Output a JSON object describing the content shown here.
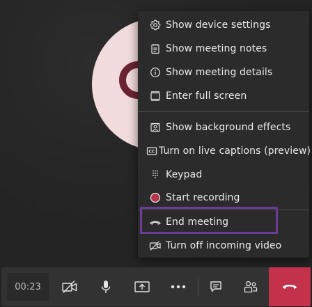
{
  "colors": {
    "background": "#262626",
    "menu_background": "#2b2b2b",
    "avatar_fill": "#f1dbdc",
    "avatar_ring": "#6a2331",
    "highlight_border": "#6b3d96",
    "end_call": "#c4314b",
    "record_dot": "#b8364c"
  },
  "menu": {
    "items": [
      {
        "label": "Show device settings",
        "icon": "gear-icon"
      },
      {
        "label": "Show meeting notes",
        "icon": "notes-icon"
      },
      {
        "label": "Show meeting details",
        "icon": "info-icon"
      },
      {
        "label": "Enter full screen",
        "icon": "fullscreen-icon"
      },
      {
        "label": "Show background effects",
        "icon": "background-effects-icon"
      },
      {
        "label": "Turn on live captions (preview)",
        "icon": "captions-icon"
      },
      {
        "label": "Keypad",
        "icon": "keypad-icon"
      },
      {
        "label": "Start recording",
        "icon": "record-icon"
      },
      {
        "label": "End meeting",
        "icon": "hang-up-icon"
      },
      {
        "label": "Turn off incoming video",
        "icon": "video-off-icon"
      }
    ]
  },
  "toolbar": {
    "timer": "00:23",
    "buttons": [
      {
        "name": "camera-off-button",
        "icon": "camera-off-icon"
      },
      {
        "name": "microphone-button",
        "icon": "microphone-icon"
      },
      {
        "name": "share-screen-button",
        "icon": "share-screen-icon"
      },
      {
        "name": "more-actions-button",
        "icon": "more-icon"
      },
      {
        "name": "chat-button",
        "icon": "chat-icon"
      },
      {
        "name": "participants-button",
        "icon": "participants-icon"
      },
      {
        "name": "hang-up-button",
        "icon": "hang-up-icon"
      }
    ]
  }
}
